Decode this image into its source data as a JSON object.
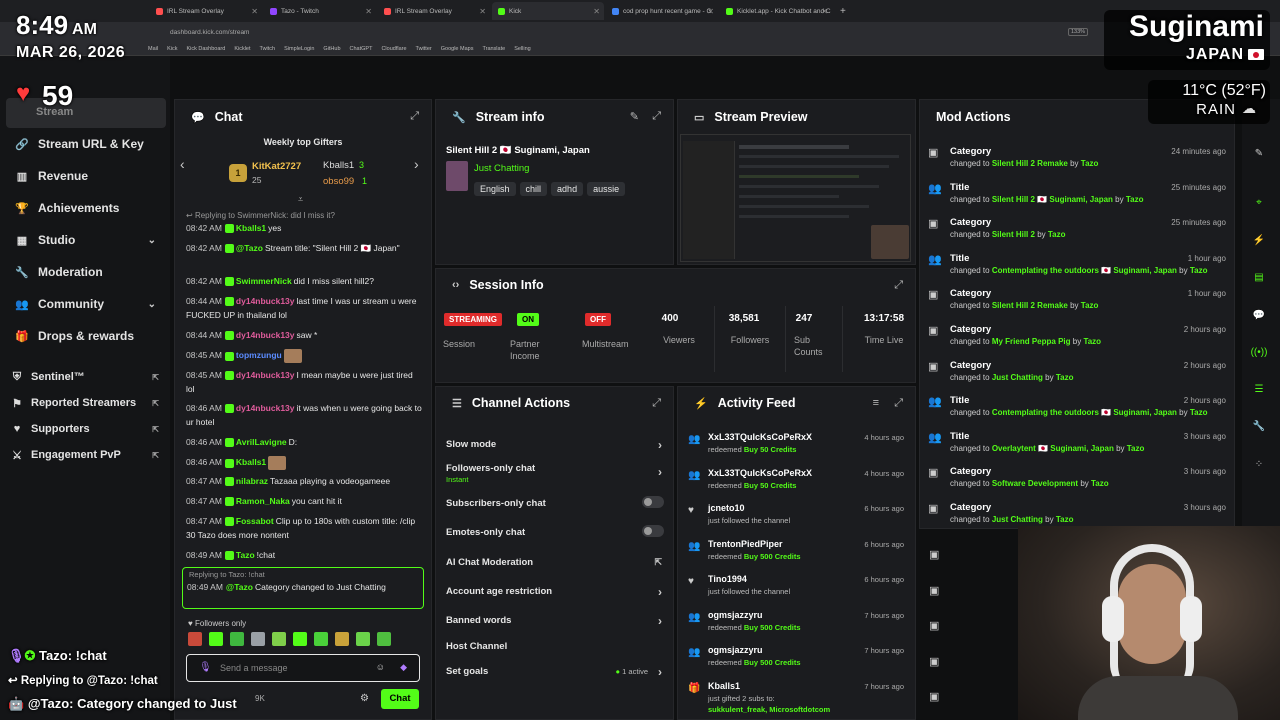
{
  "browser": {
    "tabs": [
      {
        "label": "IRL Stream Overlay"
      },
      {
        "label": "Tazo - Twitch"
      },
      {
        "label": "IRL Stream Overlay"
      },
      {
        "label": "Kick"
      },
      {
        "label": "cod prop hunt recent game - G"
      },
      {
        "label": "Kicklet.app - Kick Chatbot and C"
      }
    ],
    "url": "dashboard.kick.com/stream",
    "zoom": "133%",
    "bookmarks": [
      "Mail",
      "Kick",
      "Kick Dashboard",
      "Kicklet",
      "Twitch",
      "SimpleLogin",
      "GitHub",
      "ChatGPT",
      "Cloudflare",
      "Twitter",
      "Google Maps",
      "Translate",
      "Selling"
    ]
  },
  "overlay": {
    "time": "8:49",
    "ampm": "AM",
    "date": "MAR 26, 2026",
    "heart_rate": "59",
    "city": "Suginami",
    "country": "JAPAN",
    "weather_temp": "11°C (52°F)",
    "weather_cond": "RAIN",
    "chat_line1": "Tazo: !chat",
    "chat_line2": "Replying to @Tazo: !chat",
    "chat_line3": "@Tazo: Category changed to Just"
  },
  "sidebar": {
    "items": [
      {
        "label": "Stream",
        "icon": "play-icon"
      },
      {
        "label": "Stream URL & Key",
        "icon": "link-icon"
      },
      {
        "label": "Revenue",
        "icon": "chart-icon"
      },
      {
        "label": "Achievements",
        "icon": "trophy-icon"
      },
      {
        "label": "Studio",
        "icon": "grid-icon"
      },
      {
        "label": "Moderation",
        "icon": "wrench-icon"
      },
      {
        "label": "Community",
        "icon": "users-icon"
      },
      {
        "label": "Drops & rewards",
        "icon": "gift-icon"
      }
    ],
    "ext_items": [
      {
        "label": "Sentinel™"
      },
      {
        "label": "Reported Streamers"
      },
      {
        "label": "Supporters"
      },
      {
        "label": "Engagement PvP"
      }
    ]
  },
  "chat": {
    "title": "Chat",
    "gifters_title": "Weekly top Gifters",
    "gifters": [
      {
        "name": "KitKat2727",
        "count": "25"
      },
      {
        "name": "Kballs1",
        "count": "3"
      },
      {
        "name": "obso99",
        "count": "1"
      }
    ],
    "reply_hint": "Replying to SwimmerNick: did I miss it?",
    "messages": [
      {
        "time": "08:42 AM",
        "user": "Kballs1",
        "color": "#53fc18",
        "text": "yes"
      },
      {
        "time": "08:42 AM",
        "user": "@Tazo",
        "color": "#53fc18",
        "text": "Stream title: \"Silent Hill 2 🇯🇵 Japan\""
      },
      {
        "time": "08:42 AM",
        "user": "SwimmerNick",
        "color": "#53fc18",
        "text": "did I miss silent hill2?"
      },
      {
        "time": "08:44 AM",
        "user": "dy14nbuck13y",
        "color": "#e05c9c",
        "text": "last time I was ur stream u were FUCKED UP in thailand lol"
      },
      {
        "time": "08:44 AM",
        "user": "dy14nbuck13y",
        "color": "#e05c9c",
        "text": "saw *"
      },
      {
        "time": "08:45 AM",
        "user": "topmzungu",
        "color": "#5b8cff",
        "text": ""
      },
      {
        "time": "08:45 AM",
        "user": "dy14nbuck13y",
        "color": "#e05c9c",
        "text": "I mean maybe u were just tired lol"
      },
      {
        "time": "08:46 AM",
        "user": "dy14nbuck13y",
        "color": "#e05c9c",
        "text": "it was when u were going back to ur hotel"
      },
      {
        "time": "08:46 AM",
        "user": "AvrilLavigne",
        "color": "#53fc18",
        "text": "D:"
      },
      {
        "time": "08:46 AM",
        "user": "Kballs1",
        "color": "#53fc18",
        "text": ""
      },
      {
        "time": "08:47 AM",
        "user": "nilabraz",
        "color": "#53fc18",
        "text": "Tazaaa playing a vodeogameee"
      },
      {
        "time": "08:47 AM",
        "user": "Ramon_Naka",
        "color": "#53fc18",
        "text": "you cant hit it"
      },
      {
        "time": "08:47 AM",
        "user": "Fossabot",
        "color": "#53fc18",
        "text": "Clip up to 180s with custom title: /clip 30 Tazo does more nontent"
      },
      {
        "time": "08:49 AM",
        "user": "Tazo",
        "color": "#53fc18",
        "text": "!chat"
      }
    ],
    "highlight_reply": "Replying to Tazo: !chat",
    "highlight_time": "08:49 AM",
    "highlight_user": "@Tazo",
    "highlight_text": "Category changed to Just Chatting",
    "followers_only": "Followers only",
    "input_placeholder": "Send a message",
    "send_label": "Chat",
    "footer_count": "9K"
  },
  "stream_info": {
    "title": "Stream info",
    "stream_title": "Silent Hill 2 🇯🇵 Suginami, Japan",
    "category": "Just Chatting",
    "tags": [
      "English",
      "chill",
      "adhd",
      "aussie"
    ]
  },
  "preview": {
    "title": "Stream Preview"
  },
  "session": {
    "title": "Session Info",
    "status": {
      "pill": "STREAMING",
      "label": "Session"
    },
    "partner": {
      "pill": "ON",
      "label": "Partner Income"
    },
    "multistream": {
      "pill": "OFF",
      "label": "Multistream"
    },
    "viewers": {
      "value": "400",
      "label": "Viewers"
    },
    "followers": {
      "value": "38,581",
      "label": "Followers"
    },
    "subs": {
      "value": "247",
      "label": "Sub Counts"
    },
    "time": {
      "value": "13:17:58",
      "label": "Time Live"
    }
  },
  "channel_actions": {
    "title": "Channel Actions",
    "items": [
      {
        "label": "Slow mode"
      },
      {
        "label": "Followers-only chat",
        "sub": "Instant"
      },
      {
        "label": "Subscribers-only chat"
      },
      {
        "label": "Emotes-only chat"
      },
      {
        "label": "AI Chat Moderation"
      },
      {
        "label": "Account age restriction"
      },
      {
        "label": "Banned words"
      },
      {
        "label": "Host Channel"
      },
      {
        "label": "Set goals",
        "sub": "1 active"
      }
    ]
  },
  "activity": {
    "title": "Activity Feed",
    "items": [
      {
        "name": "XxL33TQuIcKsCoPeRxX",
        "action": "redeemed",
        "item": "Buy 50 Credits",
        "time": "4 hours ago",
        "icon": "users-icon"
      },
      {
        "name": "XxL33TQuIcKsCoPeRxX",
        "action": "redeemed",
        "item": "Buy 50 Credits",
        "time": "4 hours ago",
        "icon": "users-icon"
      },
      {
        "name": "jcneto10",
        "action": "just followed the channel",
        "item": "",
        "time": "6 hours ago",
        "icon": "heart-icon"
      },
      {
        "name": "TrentonPiedPiper",
        "action": "redeemed",
        "item": "Buy 500 Credits",
        "time": "6 hours ago",
        "icon": "users-icon"
      },
      {
        "name": "Tino1994",
        "action": "just followed the channel",
        "item": "",
        "time": "6 hours ago",
        "icon": "heart-icon"
      },
      {
        "name": "ogmsjazzyru",
        "action": "redeemed",
        "item": "Buy 500 Credits",
        "time": "7 hours ago",
        "icon": "users-icon"
      },
      {
        "name": "ogmsjazzyru",
        "action": "redeemed",
        "item": "Buy 500 Credits",
        "time": "7 hours ago",
        "icon": "users-icon"
      },
      {
        "name": "Kballs1",
        "action": "just gifted 2 subs to:",
        "item": "sukkulent_freak, Microsoftdotcom",
        "time": "7 hours ago",
        "icon": "gift-icon"
      }
    ]
  },
  "mod": {
    "title": "Mod Actions",
    "items": [
      {
        "type": "Category",
        "value": "Silent Hill 2 Remake",
        "by": "Tazo",
        "time": "24 minutes ago"
      },
      {
        "type": "Title",
        "value": "Silent Hill 2 🇯🇵 Suginami, Japan",
        "by": "Tazo",
        "time": "25 minutes ago"
      },
      {
        "type": "Category",
        "value": "Silent Hill 2",
        "by": "Tazo",
        "time": "25 minutes ago"
      },
      {
        "type": "Title",
        "value": "Contemplating the outdoors 🇯🇵 Suginami, Japan",
        "by": "Tazo",
        "time": "1 hour ago"
      },
      {
        "type": "Category",
        "value": "Silent Hill 2 Remake",
        "by": "Tazo",
        "time": "1 hour ago"
      },
      {
        "type": "Category",
        "value": "My Friend Peppa Pig",
        "by": "Tazo",
        "time": "2 hours ago"
      },
      {
        "type": "Category",
        "value": "Just Chatting",
        "by": "Tazo",
        "time": "2 hours ago"
      },
      {
        "type": "Title",
        "value": "Contemplating the outdoors 🇯🇵 Suginami, Japan",
        "by": "Tazo",
        "time": "2 hours ago"
      },
      {
        "type": "Title",
        "value": "Overlaytent 🇯🇵 Suginami, Japan",
        "by": "Tazo",
        "time": "3 hours ago"
      },
      {
        "type": "Category",
        "value": "Software Development",
        "by": "Tazo",
        "time": "3 hours ago"
      },
      {
        "type": "Category",
        "value": "Just Chatting",
        "by": "Tazo",
        "time": "3 hours ago"
      }
    ],
    "changed_to": "changed to",
    "by_word": "by"
  },
  "colors": {
    "accent": "#53fc18",
    "streaming": "#e02b2b",
    "on": "#53fc18",
    "off": "#e02b2b"
  }
}
